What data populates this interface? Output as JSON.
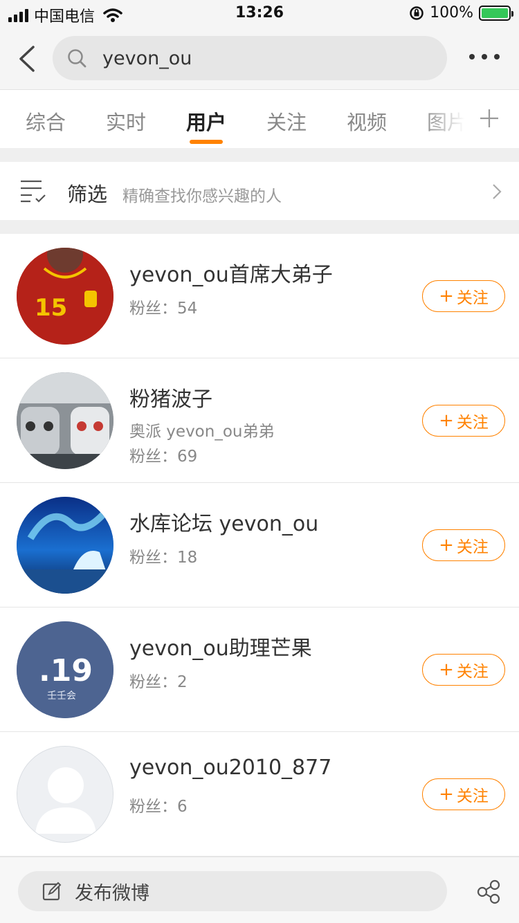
{
  "status_bar": {
    "carrier": "中国电信",
    "time": "13:26",
    "battery": "100%"
  },
  "header": {
    "search_query": "yevon_ou"
  },
  "tabs": [
    {
      "label": "综合",
      "active": false
    },
    {
      "label": "实时",
      "active": false
    },
    {
      "label": "用户",
      "active": true
    },
    {
      "label": "关注",
      "active": false
    },
    {
      "label": "视频",
      "active": false
    },
    {
      "label": "图片",
      "active": false
    }
  ],
  "filter": {
    "label": "筛选",
    "description": "精确查找你感兴趣的人"
  },
  "users": [
    {
      "name": "yevon_ou首席大弟子",
      "desc": "",
      "fans": "粉丝：54",
      "follow": "关注",
      "avatar_icon": "avatar-red-jersey"
    },
    {
      "name": "粉猪波子",
      "desc": "奥派 yevon_ou弟弟",
      "fans": "粉丝：69",
      "follow": "关注",
      "avatar_icon": "avatar-cars"
    },
    {
      "name": "水库论坛 yevon_ou",
      "desc": "",
      "fans": "粉丝：18",
      "follow": "关注",
      "avatar_icon": "avatar-aurora"
    },
    {
      "name": "yevon_ou助理芒果",
      "desc": "",
      "fans": "粉丝：2",
      "follow": "关注",
      "avatar_icon": "avatar-19-logo"
    },
    {
      "name": "yevon_ou2010_877",
      "desc": "",
      "fans": "粉丝：6",
      "follow": "关注",
      "avatar_icon": "avatar-default"
    }
  ],
  "avatar_texts": {
    "jersey_number": "15",
    "logo": ".19",
    "logo_sub": "壬壬会"
  },
  "bottom_bar": {
    "compose_label": "发布微博"
  },
  "colors": {
    "accent": "#ff8200",
    "background_gap": "#efefef"
  }
}
